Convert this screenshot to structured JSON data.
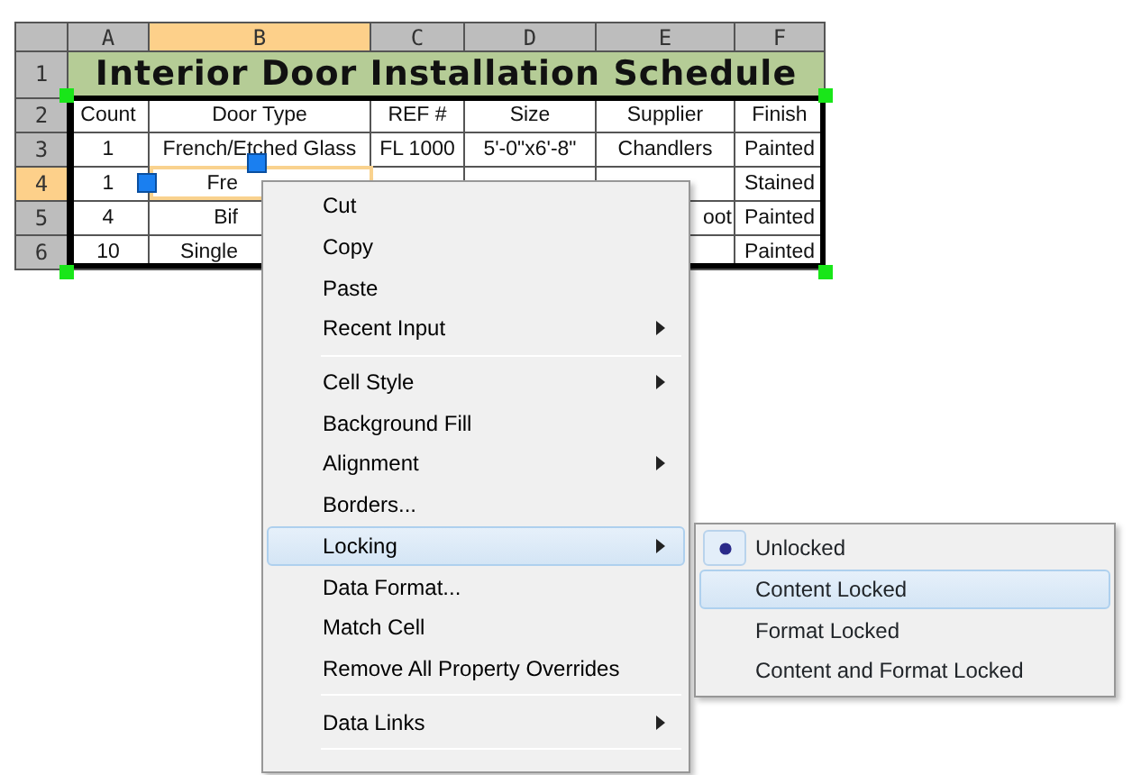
{
  "sheet": {
    "columns": [
      {
        "label": "A",
        "selected": false
      },
      {
        "label": "B",
        "selected": true
      },
      {
        "label": "C",
        "selected": false
      },
      {
        "label": "D",
        "selected": false
      },
      {
        "label": "E",
        "selected": false
      },
      {
        "label": "F",
        "selected": false
      }
    ],
    "rows": [
      {
        "label": "1",
        "selected": false,
        "kind": "title",
        "title": "Interior Door Installation Schedule"
      },
      {
        "label": "2",
        "selected": false,
        "kind": "data",
        "cells": [
          {
            "text": "Count"
          },
          {
            "text": "Door Type"
          },
          {
            "text": "REF #"
          },
          {
            "text": "Size"
          },
          {
            "text": "Supplier"
          },
          {
            "text": "Finish"
          }
        ]
      },
      {
        "label": "3",
        "selected": false,
        "kind": "data",
        "cells": [
          {
            "text": "1"
          },
          {
            "text": "French/Etched Glass"
          },
          {
            "text": "FL 1000"
          },
          {
            "text": "5'-0\"x6'-8\""
          },
          {
            "text": "Chandlers"
          },
          {
            "text": "Painted"
          }
        ]
      },
      {
        "label": "4",
        "selected": true,
        "kind": "data",
        "cells": [
          {
            "text": "1"
          },
          {
            "text": "Fre"
          },
          null,
          null,
          null,
          {
            "text": "Stained"
          }
        ]
      },
      {
        "label": "5",
        "selected": false,
        "kind": "data",
        "cells": [
          {
            "text": "4"
          },
          {
            "text": "Bif"
          },
          null,
          null,
          {
            "text": "oot"
          },
          {
            "text": "Painted"
          }
        ]
      },
      {
        "label": "6",
        "selected": false,
        "kind": "data",
        "cells": [
          {
            "text": "10"
          },
          {
            "text": "Single"
          },
          null,
          null,
          null,
          {
            "text": "Painted"
          }
        ]
      }
    ]
  },
  "context_menu": {
    "groups": [
      [
        {
          "label": "Cut",
          "submenu": false,
          "highlighted": false
        },
        {
          "label": "Copy",
          "submenu": false,
          "highlighted": false
        },
        {
          "label": "Paste",
          "submenu": false,
          "highlighted": false
        },
        {
          "label": "Recent Input",
          "submenu": true,
          "highlighted": false
        }
      ],
      [
        {
          "label": "Cell Style",
          "submenu": true,
          "highlighted": false
        },
        {
          "label": "Background Fill",
          "submenu": false,
          "highlighted": false
        },
        {
          "label": "Alignment",
          "submenu": true,
          "highlighted": false
        },
        {
          "label": "Borders...",
          "submenu": false,
          "highlighted": false
        },
        {
          "label": "Locking",
          "submenu": true,
          "highlighted": true
        },
        {
          "label": "Data Format...",
          "submenu": false,
          "highlighted": false
        },
        {
          "label": "Match Cell",
          "submenu": false,
          "highlighted": false
        },
        {
          "label": "Remove All Property Overrides",
          "submenu": false,
          "highlighted": false
        }
      ],
      [
        {
          "label": "Data Links",
          "submenu": true,
          "highlighted": false
        }
      ]
    ]
  },
  "submenu": {
    "items": [
      {
        "label": "Unlocked",
        "checked": true,
        "highlighted": false
      },
      {
        "label": "Content Locked",
        "checked": false,
        "highlighted": true
      },
      {
        "label": "Format Locked",
        "checked": false,
        "highlighted": false
      },
      {
        "label": "Content and Format Locked",
        "checked": false,
        "highlighted": false
      }
    ]
  }
}
